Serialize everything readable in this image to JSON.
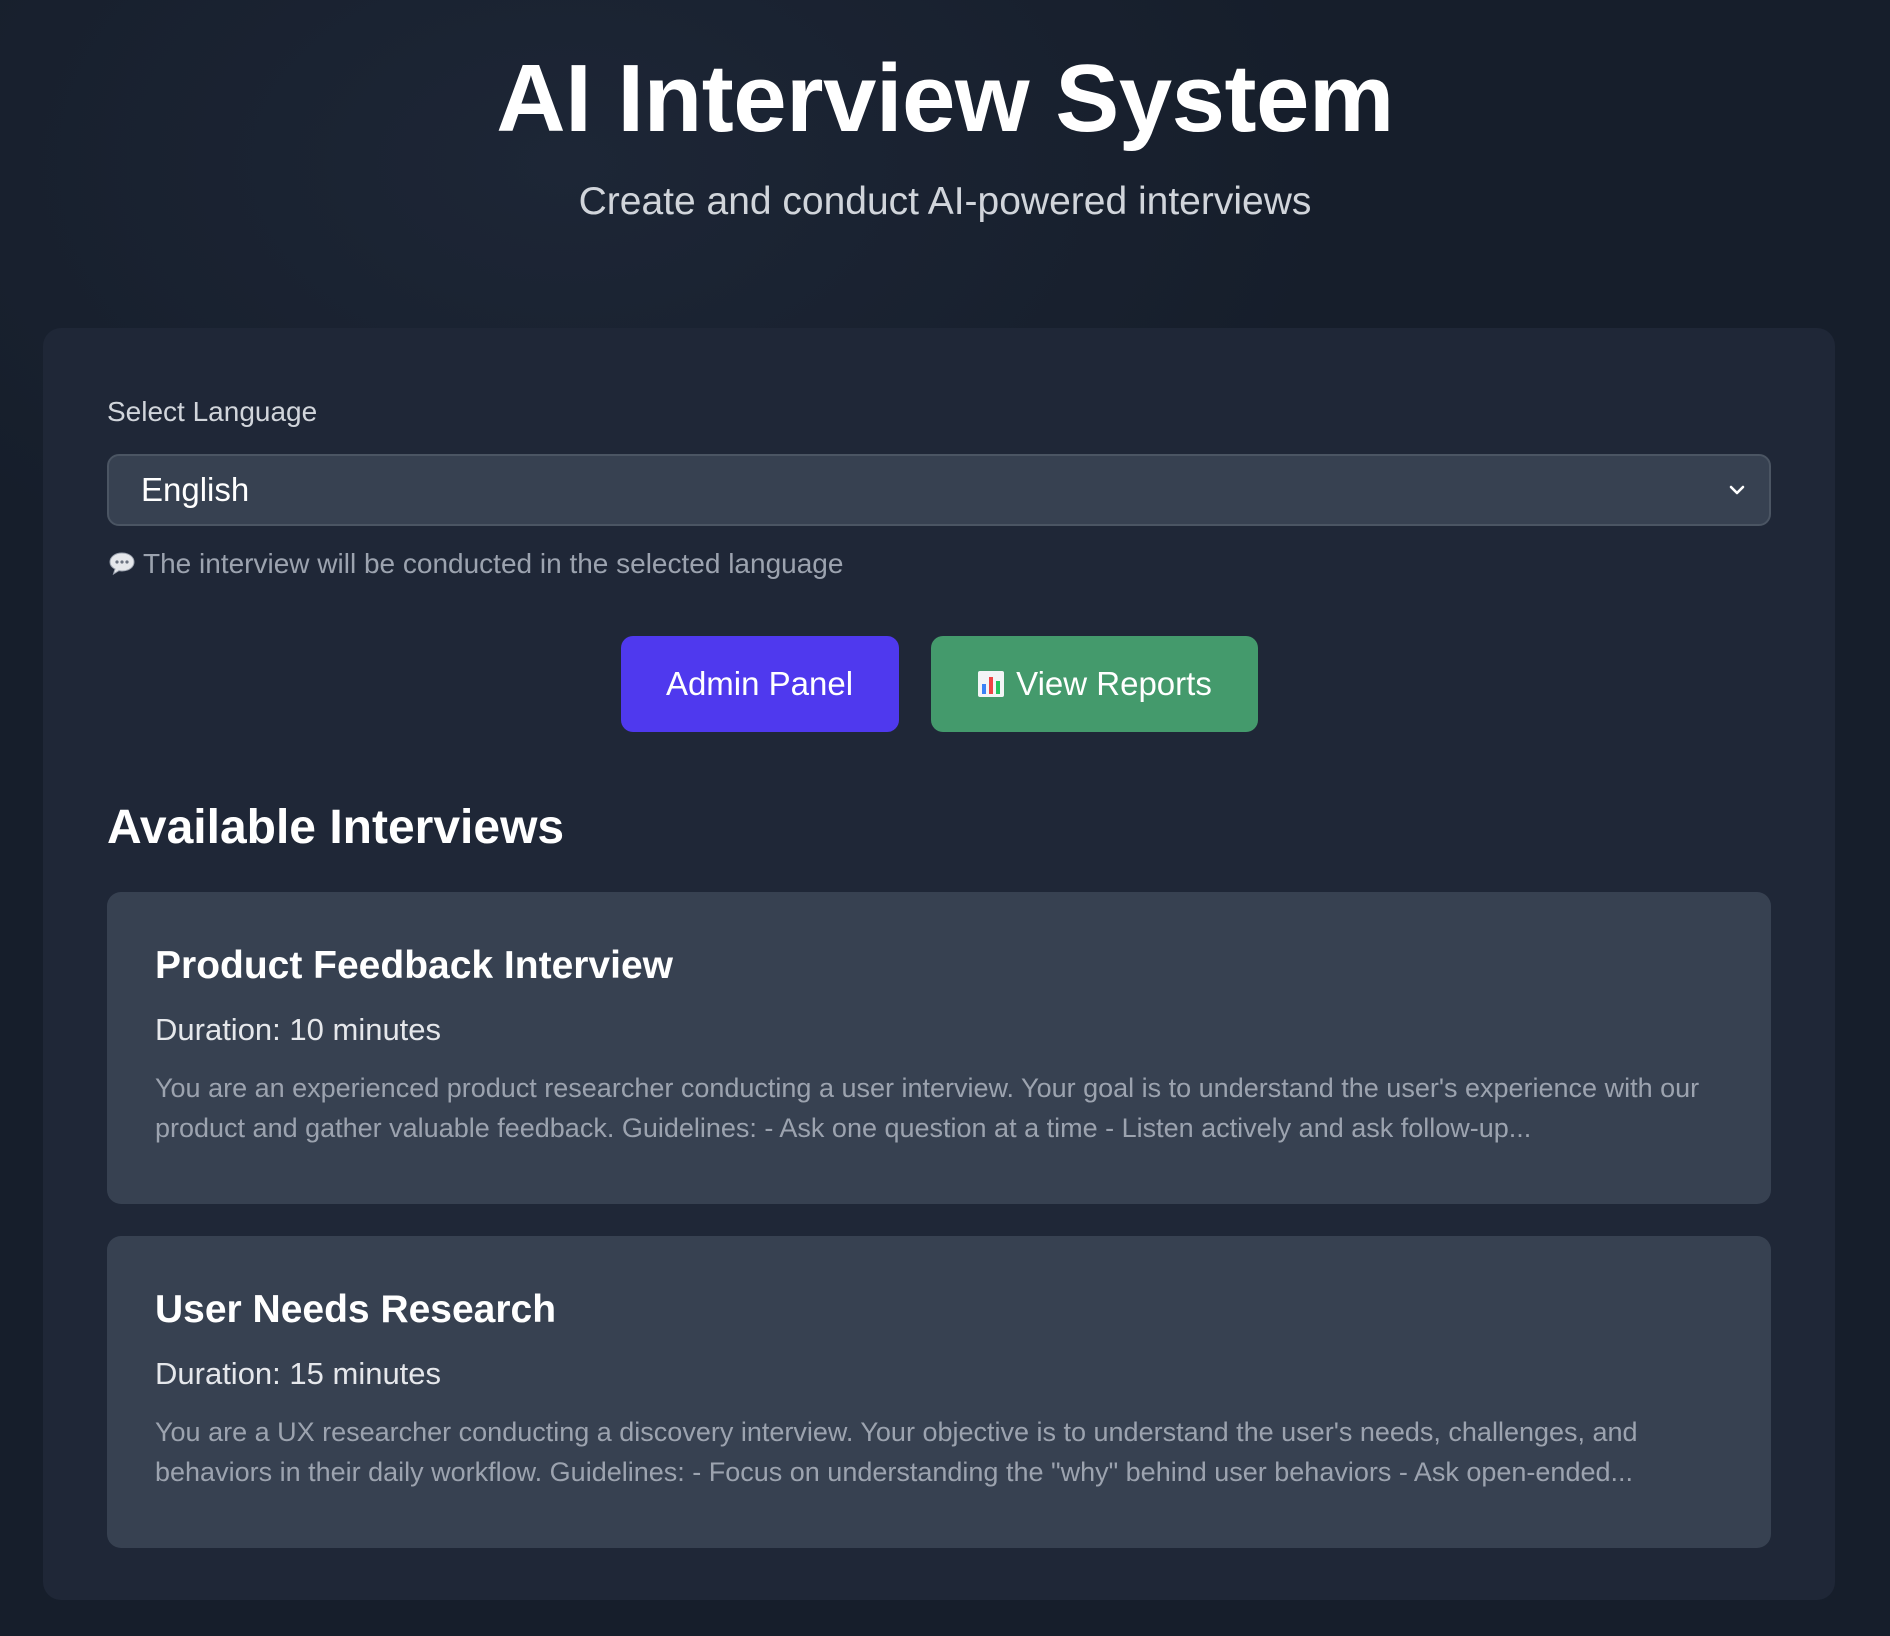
{
  "header": {
    "title": "AI Interview System",
    "subtitle": "Create and conduct AI-powered interviews"
  },
  "language": {
    "label": "Select Language",
    "selected": "English",
    "hint": "The interview will be conducted in the selected language",
    "hint_icon": "speech-bubble-icon"
  },
  "actions": {
    "admin_label": "Admin Panel",
    "reports_label": "View Reports",
    "reports_icon": "bar-chart-icon"
  },
  "colors": {
    "admin_button": "#4f39ee",
    "reports_button": "#449a6c",
    "card_background": "#1f2737",
    "interview_card_background": "#374151"
  },
  "interviews": {
    "section_title": "Available Interviews",
    "items": [
      {
        "title": "Product Feedback Interview",
        "duration": "Duration: 10 minutes",
        "description": "You are an experienced product researcher conducting a user interview. Your goal is to understand the user's experience with our product and gather valuable feedback. Guidelines: - Ask one question at a time - Listen actively and ask follow-up..."
      },
      {
        "title": "User Needs Research",
        "duration": "Duration: 15 minutes",
        "description": "You are a UX researcher conducting a discovery interview. Your objective is to understand the user's needs, challenges, and behaviors in their daily workflow. Guidelines: - Focus on understanding the \"why\" behind user behaviors - Ask open-ended..."
      }
    ]
  }
}
